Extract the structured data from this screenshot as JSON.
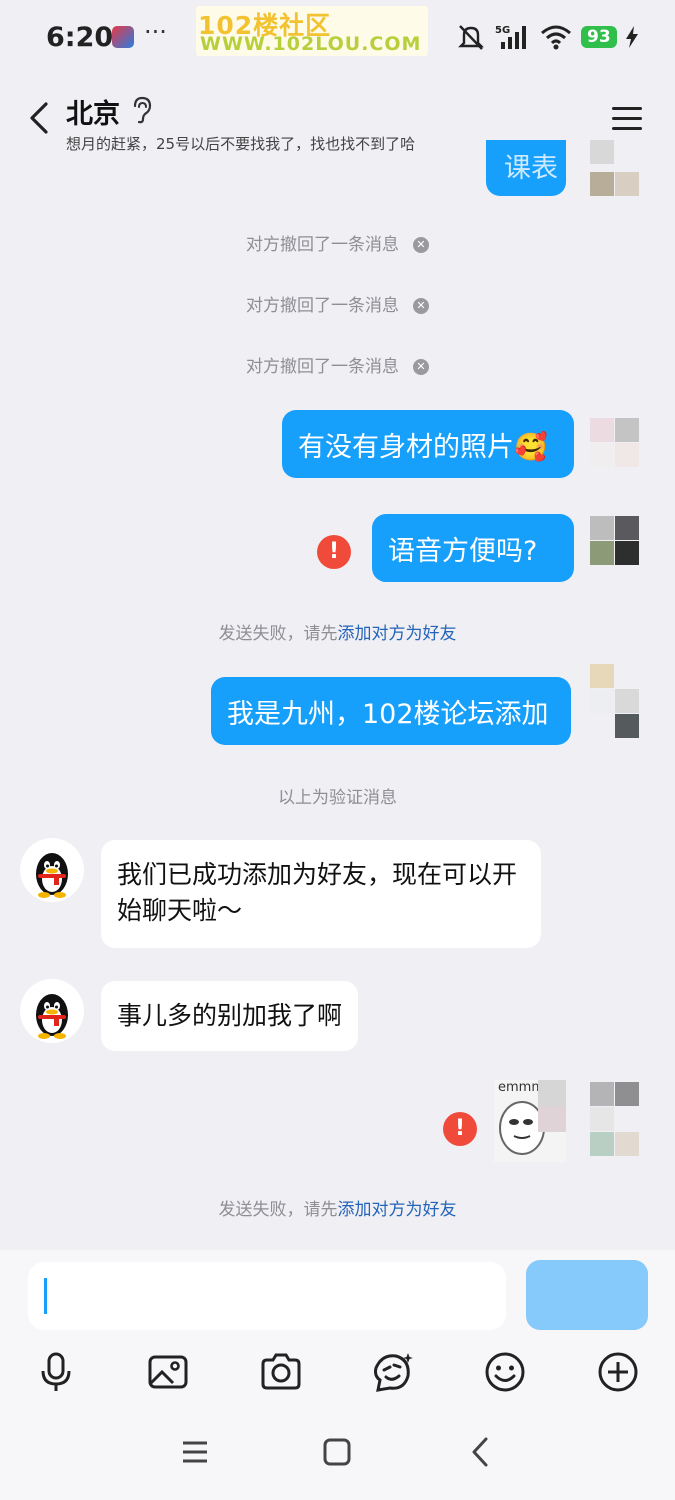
{
  "status_bar": {
    "time": "6:20",
    "more": "···",
    "watermark_line1": "102楼社区",
    "watermark_line2": "WWW.102LOU.COM",
    "network": "5G",
    "battery": "93"
  },
  "header": {
    "title": "北京",
    "subtitle": "想月的赶紧，25号以后不要找我了，找也找不到了哈"
  },
  "messages": {
    "partial_top": "课表",
    "recall_notices": [
      "对方撤回了一条消息",
      "对方撤回了一条消息",
      "对方撤回了一条消息"
    ],
    "out_1": "有没有身材的照片🥰",
    "out_2": "语音方便吗?",
    "fail_prefix": "发送失败，请先",
    "fail_link": "添加对方为好友",
    "out_3": "我是九州，102楼论坛添加",
    "verify_notice": "以上为验证消息",
    "in_1": "我们已成功添加为好友，现在可以开始聊天啦～",
    "in_2": "事儿多的别加我了啊",
    "sticker_text": "emmm",
    "fail2_prefix": "发送失败，请先",
    "fail2_link": "添加对方为好友"
  },
  "icons": {
    "toolbar": [
      "microphone-icon",
      "image-icon",
      "camera-icon",
      "sticker-icon",
      "emoji-icon",
      "plus-icon"
    ],
    "nav": [
      "recents-icon",
      "home-icon",
      "back-nav-icon"
    ]
  },
  "colors": {
    "bubble_out": "#17a0fb",
    "error": "#f04a3b",
    "link": "#2464b8"
  }
}
